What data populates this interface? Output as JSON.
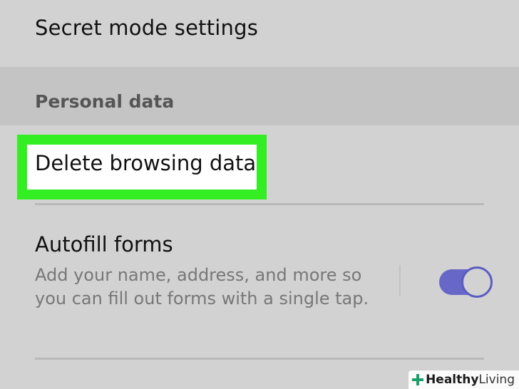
{
  "settings": {
    "secret_mode_label": "Secret mode settings",
    "section_personal_data": "Personal data",
    "delete_browsing_label": "Delete browsing data",
    "autofill": {
      "title": "Autofill forms",
      "description": "Add your name, address, and more so you can fill out forms with a single tap.",
      "enabled": true
    }
  },
  "watermark": {
    "brand_bold": "Healthy",
    "brand_light": "Living"
  },
  "colors": {
    "background": "#d2d2d2",
    "section_header_bg": "#c4c4c4",
    "highlight": "#33ee22",
    "toggle_accent": "#6767c8",
    "watermark_cross": "#1aa06a"
  },
  "icons": {
    "watermark_logo": "plus-cross-icon"
  }
}
